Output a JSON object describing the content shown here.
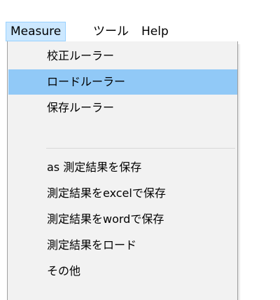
{
  "menubar": {
    "items": [
      {
        "label": "Measure"
      },
      {
        "label": "ツール"
      },
      {
        "label": "Help"
      }
    ]
  },
  "dropdown": {
    "group1": [
      {
        "label": "校正ルーラー"
      },
      {
        "label": "ロードルーラー"
      },
      {
        "label": "保存ルーラー"
      }
    ],
    "group2": [
      {
        "label": "as 測定結果を保存"
      },
      {
        "label": "測定結果をexcelで保存"
      },
      {
        "label": "測定結果をwordで保存"
      },
      {
        "label": "測定結果をロード"
      },
      {
        "label": "その他"
      }
    ]
  }
}
